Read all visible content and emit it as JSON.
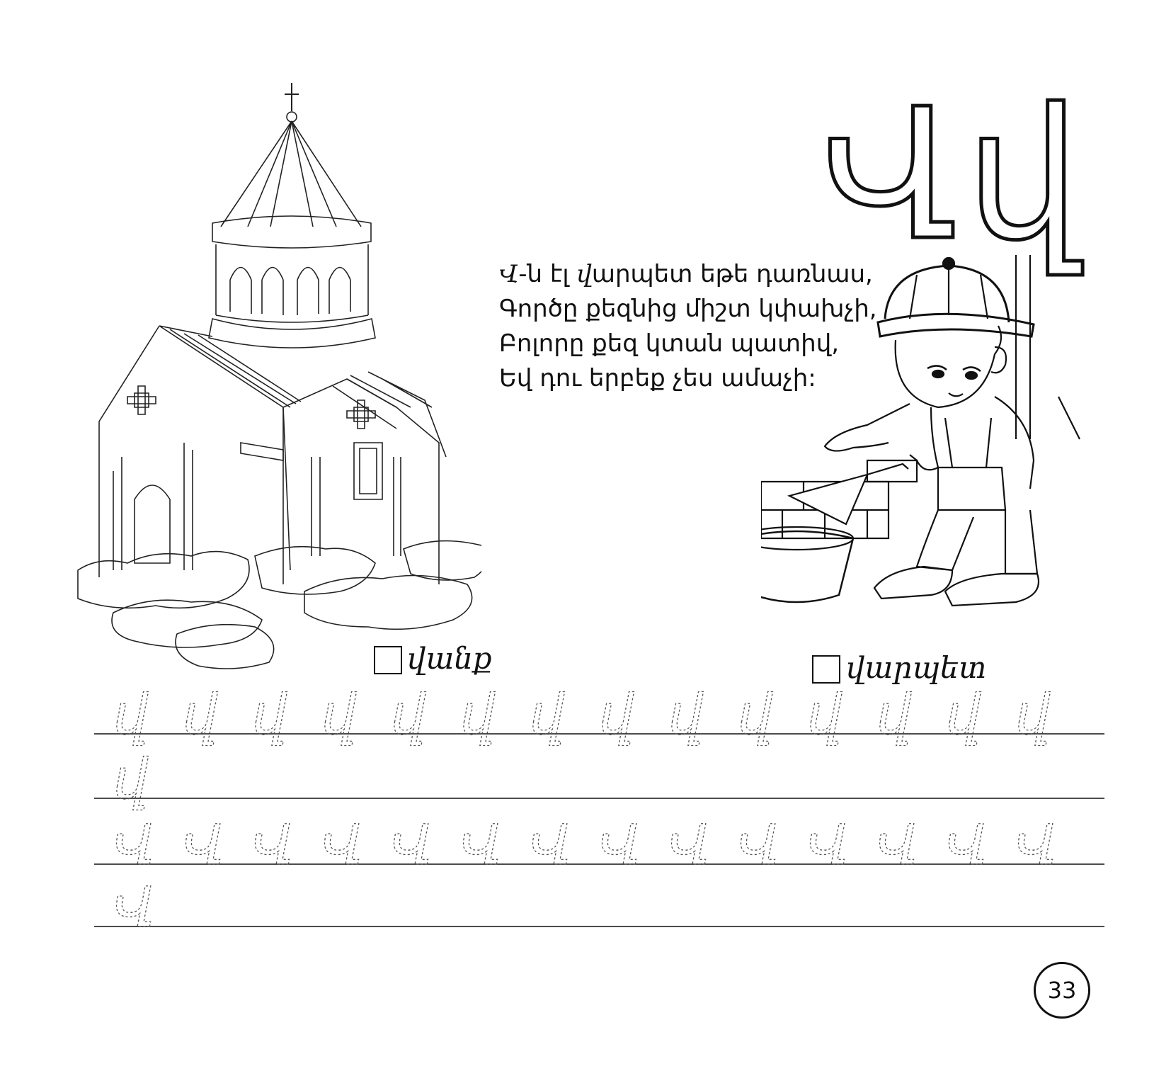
{
  "letter": {
    "upper": "Վ",
    "lower": "վ"
  },
  "poem": {
    "lines": [
      {
        "cap": "Վ",
        "rest": "-ն էլ ",
        "cap2": "վ",
        "rest2": "արպետ եթե դառնաս,"
      },
      {
        "text": "Գործը քեզնից միշտ կփախչի,"
      },
      {
        "text": "Բոլորը քեզ կտան պատիվ,"
      },
      {
        "text": "Եվ դու երբեք չես ամաչի:"
      }
    ]
  },
  "pictures": {
    "left": {
      "word": "վանք",
      "picture": "church"
    },
    "right": {
      "word": "վարպետ",
      "picture": "builder-boy"
    }
  },
  "practice": {
    "row1_glyph": "վ",
    "row2_glyph": "Վ"
  },
  "page_number": "33"
}
